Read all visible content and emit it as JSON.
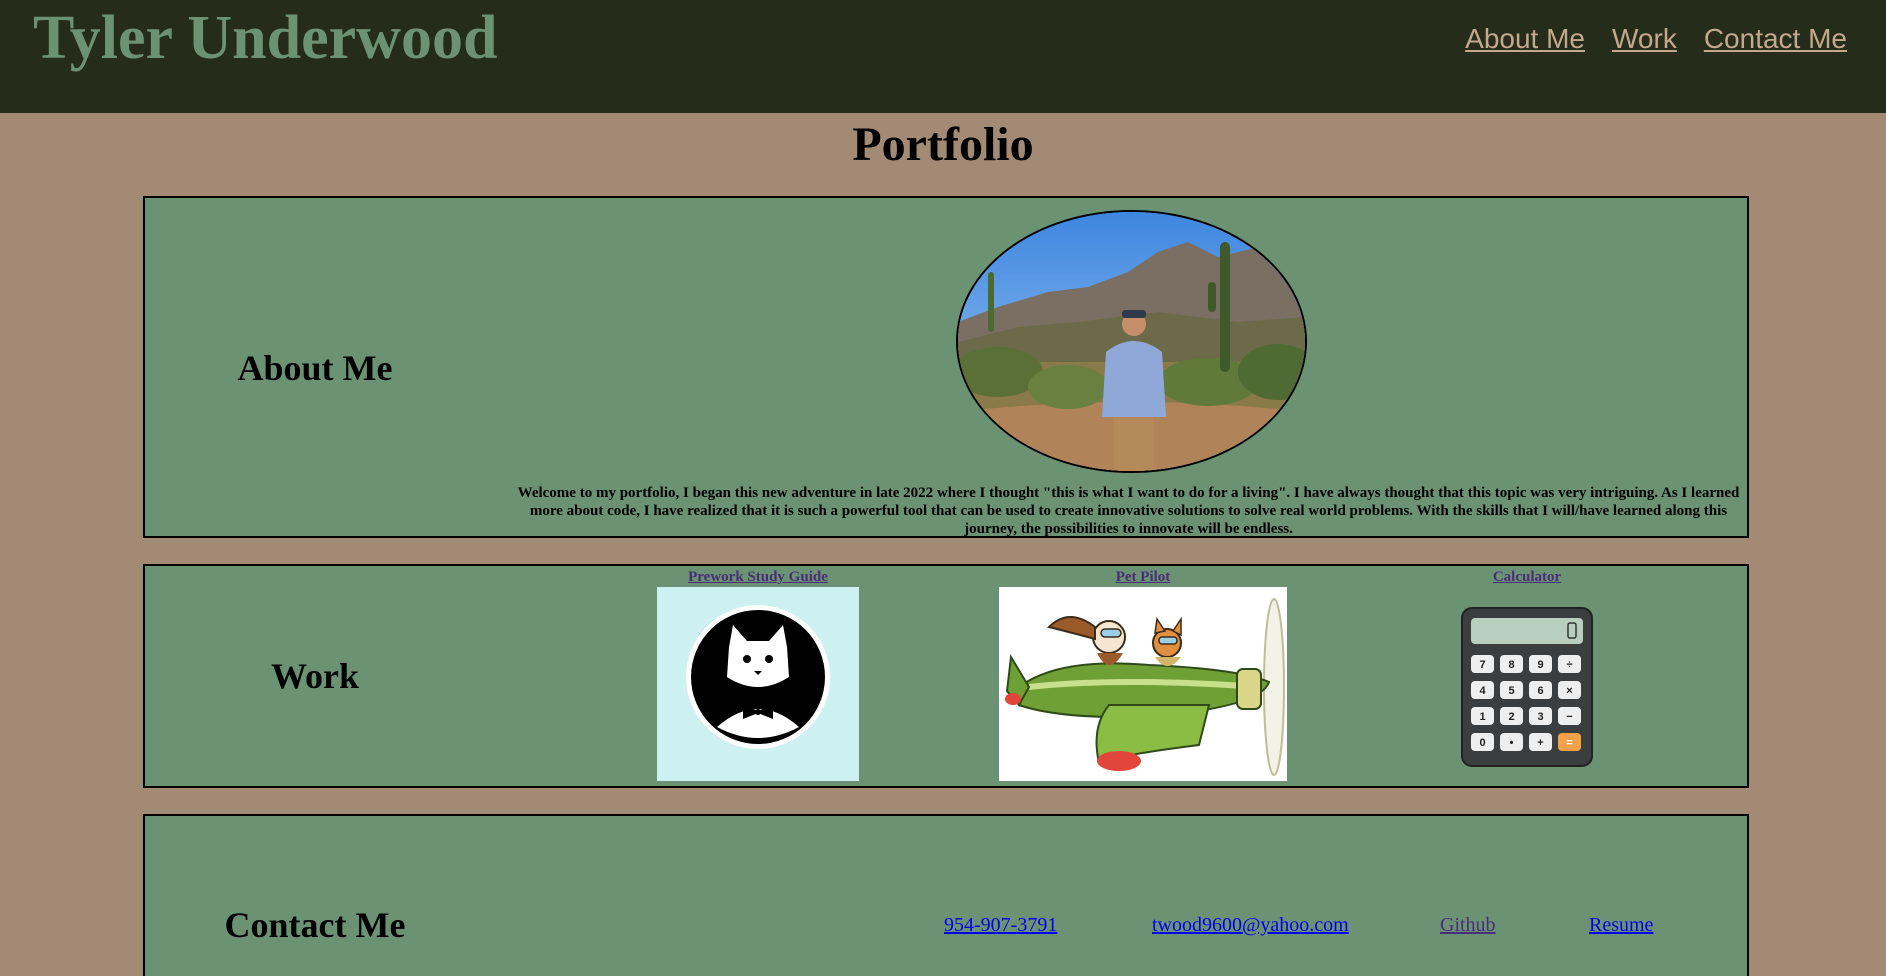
{
  "header": {
    "site_title": "Tyler Underwood",
    "nav": [
      {
        "label": "About Me"
      },
      {
        "label": "Work"
      },
      {
        "label": "Contact Me"
      }
    ]
  },
  "page": {
    "heading": "Portfolio"
  },
  "about": {
    "title": "About Me",
    "text": "Welcome to my portfolio, I began this new adventure in late 2022 where I thought \"this is what I want to do for a living\". I have always thought that this topic was very intriguing. As I learned more about code, I have realized that it is such a powerful tool that can be used to create innovative solutions to solve real world problems. With the skills that I will/have learned along this journey, the possibilities to innovate will be endless."
  },
  "work": {
    "title": "Work",
    "projects": [
      {
        "label": "Prework Study Guide"
      },
      {
        "label": "Pet Pilot"
      },
      {
        "label": "Calculator"
      }
    ]
  },
  "contact": {
    "title": "Contact Me",
    "phone": "954-907-3791",
    "email": "twood9600@yahoo.com",
    "github": "Github",
    "resume": "Resume"
  },
  "calculator_keys": [
    "7",
    "8",
    "9",
    "÷",
    "4",
    "5",
    "6",
    "×",
    "1",
    "2",
    "3",
    "−",
    "0",
    "•",
    "+",
    "="
  ],
  "colors": {
    "page_bg": "#a38a74",
    "header_bg": "#252c1a",
    "section_bg": "#6b9373",
    "title_green": "#6b9373",
    "nav_tan": "#c4a88e",
    "visited_link": "#4a2d7a",
    "link_blue": "#0000ee"
  }
}
